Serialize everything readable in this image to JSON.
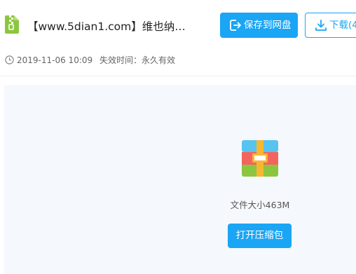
{
  "header": {
    "file_icon": "zip-file-icon",
    "title": "【www.5dian1.com】维也纳…",
    "save_button": {
      "label": "保存到网盘",
      "icon": "save-to-cloud-icon"
    },
    "download_button": {
      "label": "下载(4",
      "icon": "download-icon"
    }
  },
  "meta": {
    "clock_icon": "clock-icon",
    "date": "2019-11-06 10:09",
    "expiry": "失效时间：永久有效"
  },
  "content": {
    "archive_icon": "archive-icon",
    "file_size": "文件大小463M",
    "open_button": "打开压缩包"
  },
  "colors": {
    "accent": "#1aa5f5",
    "panel_bg": "#f5f8fc",
    "zip_icon_green": "#8cc63f"
  }
}
